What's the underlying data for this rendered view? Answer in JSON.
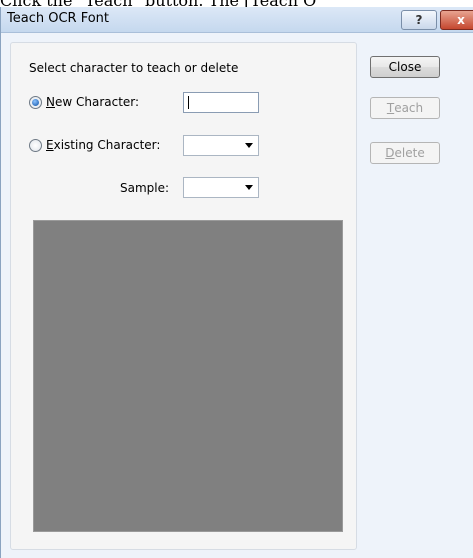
{
  "caption": "Click the \"Teach\" button. The [Teach O",
  "window": {
    "title": "Teach OCR Font",
    "help_label": "?",
    "close_label": "x"
  },
  "form": {
    "prompt": "Select character to teach or delete",
    "new_character": {
      "label": "New Character:",
      "mnemonic": "N",
      "rest": "ew Character:",
      "selected": true,
      "value": ""
    },
    "existing_character": {
      "label": "Existing Character:",
      "mnemonic": "E",
      "rest": "xisting Character:",
      "selected": false,
      "value": ""
    },
    "sample": {
      "label": "Sample:",
      "value": ""
    }
  },
  "buttons": {
    "close": "Close",
    "teach": {
      "label": "Teach",
      "mnemonic": "T",
      "rest": "each",
      "enabled": false
    },
    "delete": {
      "label": "Delete",
      "mnemonic": "D",
      "rest": "elete",
      "enabled": false
    }
  },
  "colors": {
    "preview_background": "#808080",
    "dialog_background": "#eef3fa",
    "close_button_red": "#c5472f"
  }
}
